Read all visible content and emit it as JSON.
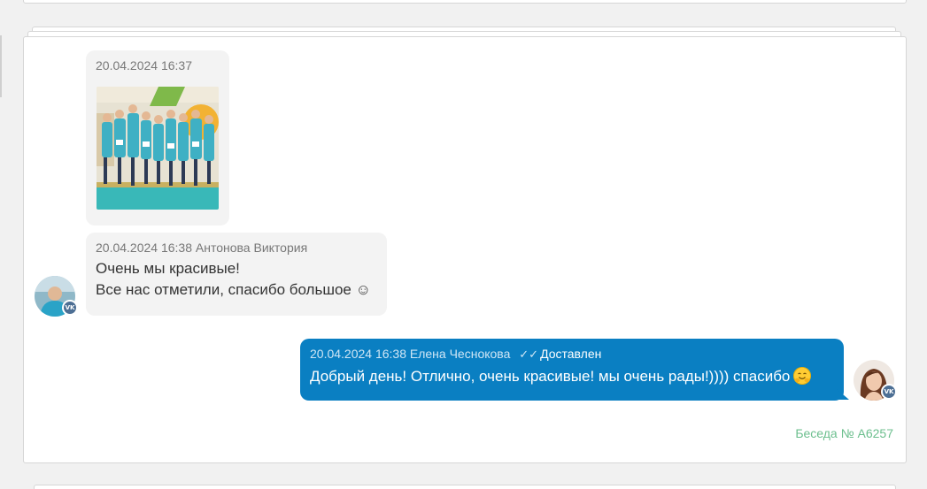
{
  "messages": [
    {
      "direction": "incoming",
      "timestamp": "20.04.2024 16:37",
      "author": "",
      "attachment": "photo",
      "text_lines": []
    },
    {
      "direction": "incoming",
      "timestamp": "20.04.2024 16:38",
      "author": "Антонова Виктория",
      "text_lines": [
        "Очень мы красивые!",
        "Все нас отметили, спасибо большое ☺"
      ],
      "avatar_badge": "VK"
    },
    {
      "direction": "outgoing",
      "timestamp": "20.04.2024 16:38",
      "author": "Елена Чеснокова",
      "status": "Доставлен",
      "text": "Добрый день! Отлично, очень красивые! мы очень рады!)))) спасибо",
      "avatar_badge": "VK"
    }
  ],
  "conversation_label": "Беседа № А6257",
  "colors": {
    "outgoing_bubble": "#0a7fc2",
    "incoming_bubble": "#f3f3f3",
    "conversation_label": "#6cbf8e",
    "vk_badge": "#4d6f94"
  },
  "icons": {
    "delivered": "double-check-icon",
    "emoji": "hugging-face-emoji-icon",
    "network": "vk-icon"
  }
}
